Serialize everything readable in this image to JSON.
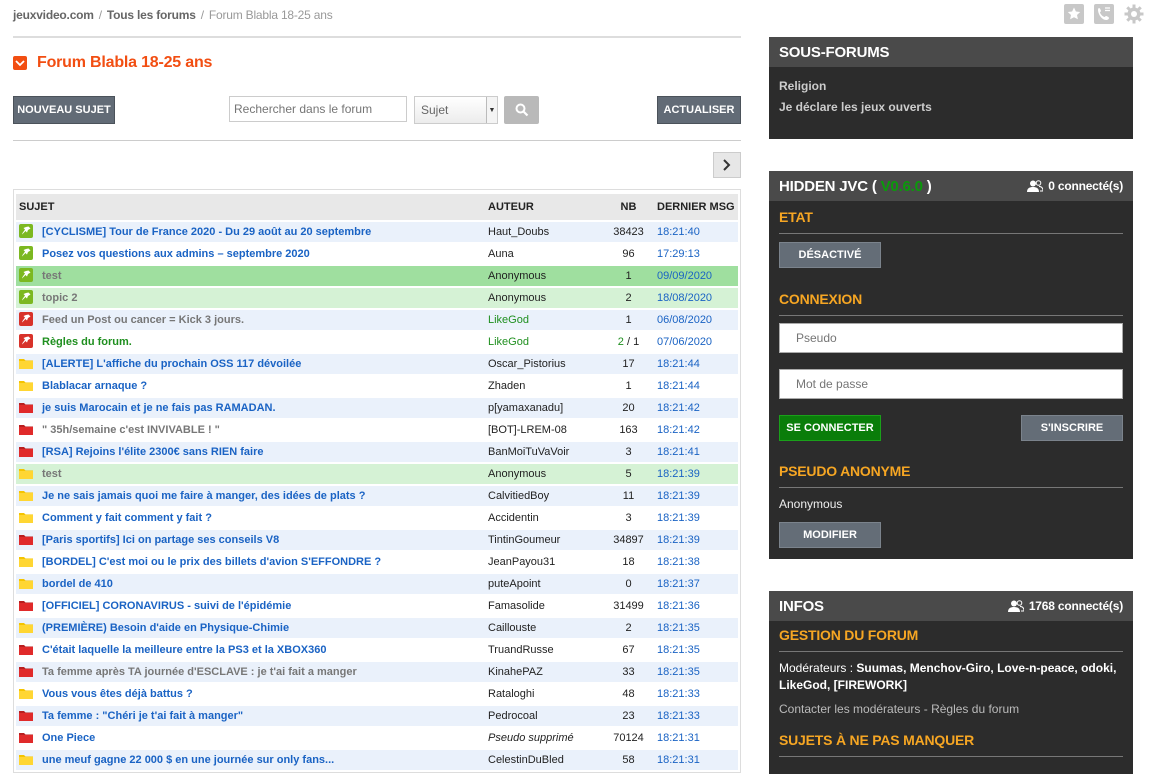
{
  "breadcrumb": {
    "site": "jeuxvideo.com",
    "all_forums": "Tous les forums",
    "current": "Forum Blabla 18-25 ans"
  },
  "top_icons": [
    "star-icon",
    "phone-icon",
    "gear-icon"
  ],
  "forum": {
    "title": "Forum Blabla 18-25 ans",
    "new_topic_label": "NOUVEAU SUJET",
    "search_placeholder": "Rechercher dans le forum",
    "search_scope": "Sujet",
    "refresh_label": "ACTUALISER"
  },
  "table": {
    "headers": {
      "subject": "SUJET",
      "author": "AUTEUR",
      "nb": "NB",
      "last": "DERNIER MSG"
    },
    "rows": [
      {
        "icon": "pin-green",
        "subject": "[CYCLISME] Tour de France 2020 - Du 29 août au 20 septembre",
        "author": "Haut_Doubs",
        "nb": "38423",
        "last": "18:21:40",
        "style": "odd",
        "subject_style": "",
        "author_style": ""
      },
      {
        "icon": "pin-green",
        "subject": "Posez vos questions aux admins – septembre 2020",
        "author": "Auna",
        "nb": "96",
        "last": "17:29:13",
        "style": "even",
        "subject_style": "",
        "author_style": ""
      },
      {
        "icon": "pin-green",
        "subject": "test",
        "author": "Anonymous",
        "nb": "1",
        "last": "09/09/2020",
        "style": "green",
        "subject_style": "read",
        "author_style": ""
      },
      {
        "icon": "pin-green",
        "subject": "topic 2",
        "author": "Anonymous",
        "nb": "2",
        "last": "18/08/2020",
        "style": "lightgreen",
        "subject_style": "read",
        "author_style": ""
      },
      {
        "icon": "pin-red",
        "subject": "Feed un Post ou cancer = Kick 3 jours.",
        "author": "LikeGod",
        "nb": "1",
        "last": "06/08/2020",
        "style": "odd",
        "subject_style": "read",
        "author_style": "green-txt"
      },
      {
        "icon": "pin-red",
        "subject": "Règles du forum.",
        "author": "LikeGod",
        "nb": "2 / 1",
        "last": "07/06/2020",
        "style": "even",
        "subject_style": "green-txt",
        "author_style": "green-txt"
      },
      {
        "icon": "fold-yellow",
        "subject": "[ALERTE] L'affiche du prochain OSS 117 dévoilée",
        "author": "Oscar_Pistorius",
        "nb": "17",
        "last": "18:21:44",
        "style": "odd",
        "subject_style": "",
        "author_style": ""
      },
      {
        "icon": "fold-yellow",
        "subject": "Blablacar arnaque ?",
        "author": "Zhaden",
        "nb": "1",
        "last": "18:21:44",
        "style": "even",
        "subject_style": "",
        "author_style": ""
      },
      {
        "icon": "fold-red",
        "subject": "je suis Marocain et je ne fais pas RAMADAN.",
        "author": "p[yamaxanadu]",
        "nb": "20",
        "last": "18:21:42",
        "style": "odd",
        "subject_style": "",
        "author_style": ""
      },
      {
        "icon": "fold-red",
        "subject": "\" 35h/semaine c'est INVIVABLE ! \"",
        "author": "[BOT]-LREM-08",
        "nb": "163",
        "last": "18:21:42",
        "style": "even",
        "subject_style": "read",
        "author_style": ""
      },
      {
        "icon": "fold-red",
        "subject": "[RSA] Rejoins l'élite 2300€ sans RIEN faire",
        "author": "BanMoiTuVaVoir",
        "nb": "3",
        "last": "18:21:41",
        "style": "odd",
        "subject_style": "",
        "author_style": ""
      },
      {
        "icon": "fold-yellow",
        "subject": "test",
        "author": "Anonymous",
        "nb": "5",
        "last": "18:21:39",
        "style": "lightgreen",
        "subject_style": "read",
        "author_style": ""
      },
      {
        "icon": "fold-yellow",
        "subject": "Je ne sais jamais quoi me faire à manger, des idées de plats ?",
        "author": "CalvitiedBoy",
        "nb": "11",
        "last": "18:21:39",
        "style": "odd",
        "subject_style": "",
        "author_style": ""
      },
      {
        "icon": "fold-yellow",
        "subject": "Comment y fait comment y fait ?",
        "author": "Accidentin",
        "nb": "3",
        "last": "18:21:39",
        "style": "even",
        "subject_style": "",
        "author_style": ""
      },
      {
        "icon": "fold-red",
        "subject": "[Paris sportifs] Ici on partage ses conseils V8",
        "author": "TintinGoumeur",
        "nb": "34897",
        "last": "18:21:39",
        "style": "odd",
        "subject_style": "",
        "author_style": ""
      },
      {
        "icon": "fold-yellow",
        "subject": "[BORDEL] C'est moi ou le prix des billets d'avion S'EFFONDRE ?",
        "author": "JeanPayou31",
        "nb": "18",
        "last": "18:21:38",
        "style": "even",
        "subject_style": "",
        "author_style": ""
      },
      {
        "icon": "fold-yellow",
        "subject": "bordel de 410",
        "author": "puteApoint",
        "nb": "0",
        "last": "18:21:37",
        "style": "odd",
        "subject_style": "",
        "author_style": ""
      },
      {
        "icon": "fold-red",
        "subject": "[OFFICIEL] CORONAVIRUS - suivi de l'épidémie",
        "author": "Famasolide",
        "nb": "31499",
        "last": "18:21:36",
        "style": "even",
        "subject_style": "",
        "author_style": ""
      },
      {
        "icon": "fold-yellow",
        "subject": "(PREMIÈRE) Besoin d'aide en Physique-Chimie",
        "author": "Caillouste",
        "nb": "2",
        "last": "18:21:35",
        "style": "odd",
        "subject_style": "",
        "author_style": ""
      },
      {
        "icon": "fold-red",
        "subject": "C'était laquelle la meilleure entre la PS3 et la XBOX360",
        "author": "TruandRusse",
        "nb": "67",
        "last": "18:21:35",
        "style": "even",
        "subject_style": "",
        "author_style": ""
      },
      {
        "icon": "fold-red",
        "subject": "Ta femme après TA journée d'ESCLAVE : je t'ai fait a manger",
        "author": "KinahePAZ",
        "nb": "33",
        "last": "18:21:35",
        "style": "odd",
        "subject_style": "read",
        "author_style": ""
      },
      {
        "icon": "fold-yellow",
        "subject": "Vous vous êtes déjà battus ?",
        "author": "Rataloghi",
        "nb": "48",
        "last": "18:21:33",
        "style": "even",
        "subject_style": "",
        "author_style": ""
      },
      {
        "icon": "fold-red",
        "subject": "Ta femme : \"Chéri je t'ai fait à manger\"",
        "author": "Pedrocoal",
        "nb": "23",
        "last": "18:21:33",
        "style": "odd",
        "subject_style": "",
        "author_style": ""
      },
      {
        "icon": "fold-red",
        "subject": "One Piece",
        "author": "Pseudo supprimé",
        "nb": "70124",
        "last": "18:21:31",
        "style": "even",
        "subject_style": "",
        "author_style": "italic"
      },
      {
        "icon": "fold-yellow",
        "subject": "une meuf gagne 22 000 $ en une journée sur only fans...",
        "author": "CelestinDuBled",
        "nb": "58",
        "last": "18:21:31",
        "style": "odd",
        "subject_style": "",
        "author_style": ""
      }
    ]
  },
  "sidebar": {
    "subforums": {
      "title": "SOUS-FORUMS",
      "items": [
        "Religion",
        "Je déclare les jeux ouverts"
      ]
    },
    "hidden": {
      "title": "HIDDEN JVC (",
      "version": "V0.6.0",
      "title_end": ")",
      "connected": "0 connecté(s)",
      "etat_title": "ETAT",
      "etat_button": "DÉSACTIVÉ",
      "login_title": "CONNEXION",
      "pseudo_placeholder": "Pseudo",
      "password_placeholder": "Mot de passe",
      "login_button": "SE CONNECTER",
      "register_button": "S'INSCRIRE",
      "anon_title": "PSEUDO ANONYME",
      "anon_value": "Anonymous",
      "modify_button": "MODIFIER"
    },
    "infos": {
      "title": "INFOS",
      "connected": "1768 connecté(s)",
      "gestion_title": "GESTION DU FORUM",
      "moderators_label": "Modérateurs :",
      "moderators": "Suumas, Menchov-Giro, Love-n-peace, odoki, LikeGod, [FIREWORK]",
      "contact": "Contacter les modérateurs",
      "contact_sep": " - ",
      "rules": "Règles du forum",
      "must_see_title": "SUJETS À NE PAS MANQUER"
    }
  },
  "colors": {
    "accent": "#f24e12",
    "link": "#1a63c4",
    "sidebar_bg": "#2c2c2c",
    "sidebar_head": "#4a4a4a",
    "section_title": "#f6a623",
    "login_green": "#0a7d0a"
  }
}
